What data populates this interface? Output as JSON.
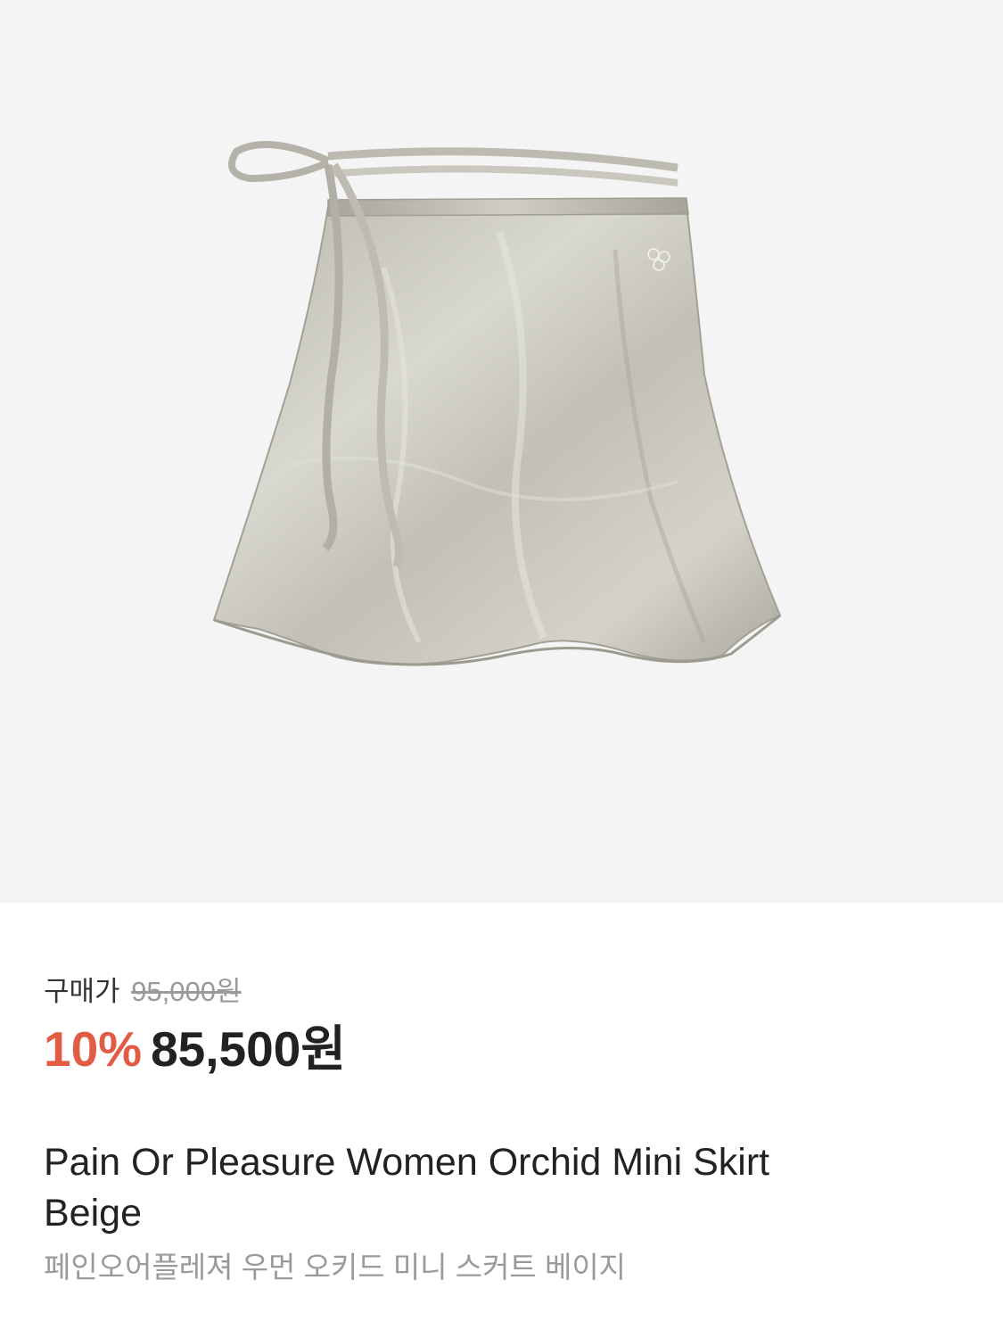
{
  "product": {
    "image_alt": "beige satin wrap mini skirt product photo",
    "price_label": "구매가",
    "original_price": "95,000원",
    "discount": "10%",
    "sale_price": "85,500원",
    "title": "Pain Or Pleasure Women Orchid Mini Skirt Beige",
    "title_korean": "페인오어플레져 우먼  오키드 미니 스커트 베이지"
  },
  "colors": {
    "image_background": "#f4f4f4",
    "discount": "#e25c45",
    "text_primary": "#222222",
    "text_muted": "#9a9a9a"
  }
}
